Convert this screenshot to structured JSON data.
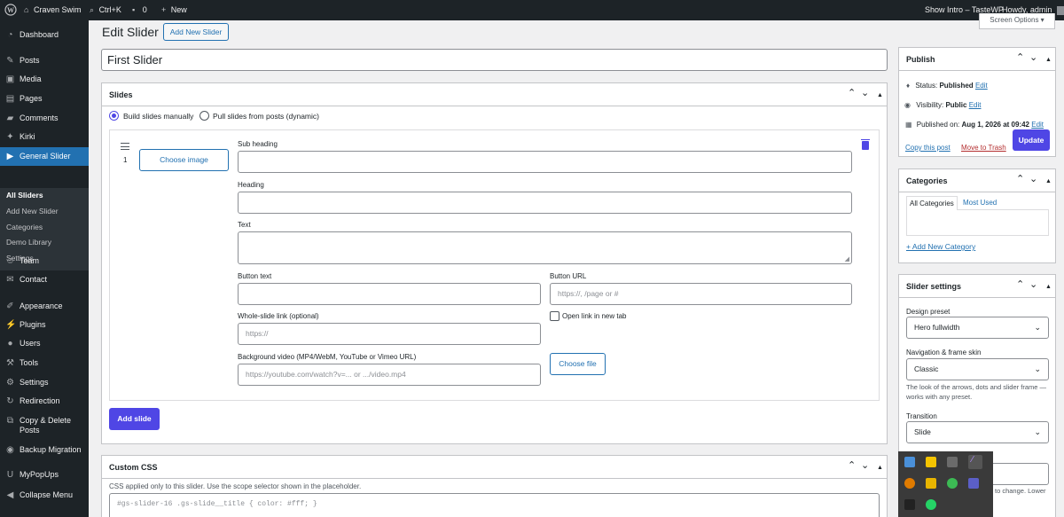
{
  "admin_bar": {
    "site_name": "Craven Swim",
    "shortcut": "Ctrl+K",
    "comments_count": "0",
    "new_label": "New",
    "show_intro": "Show Intro – TasteWP",
    "howdy": "Howdy, admin"
  },
  "sidebar": {
    "items": [
      {
        "label": "Dashboard",
        "icon": "dashboard-icon"
      },
      {
        "label": "Posts",
        "icon": "pin-icon"
      },
      {
        "label": "Media",
        "icon": "media-icon"
      },
      {
        "label": "Pages",
        "icon": "pages-icon"
      },
      {
        "label": "Comments",
        "icon": "comment-icon"
      },
      {
        "label": "Kirki",
        "icon": "kirki-icon"
      },
      {
        "label": "General Slider",
        "icon": "slider-icon"
      },
      {
        "label": "Team",
        "icon": "team-icon"
      },
      {
        "label": "Contact",
        "icon": "mail-icon"
      },
      {
        "label": "Appearance",
        "icon": "brush-icon"
      },
      {
        "label": "Plugins",
        "icon": "plugin-icon"
      },
      {
        "label": "Users",
        "icon": "user-icon"
      },
      {
        "label": "Tools",
        "icon": "wrench-icon"
      },
      {
        "label": "Settings",
        "icon": "settings-icon"
      },
      {
        "label": "Redirection",
        "icon": "redirect-icon"
      },
      {
        "label": "Copy & Delete",
        "label2": "Posts",
        "icon": "copy-icon"
      },
      {
        "label": "Backup Migration",
        "icon": "backup-icon"
      },
      {
        "label": "MyPopUps",
        "icon": "popup-icon"
      },
      {
        "label": "Collapse Menu",
        "icon": "collapse-icon"
      }
    ],
    "submenu": [
      "All Sliders",
      "Add New Slider",
      "Categories",
      "Demo Library",
      "Settings"
    ]
  },
  "page": {
    "title": "Edit Slider",
    "add_new": "Add New Slider",
    "screen_options": "Screen Options ▾",
    "slider_title": "First Slider"
  },
  "slides": {
    "title": "Slides",
    "radio_manual": "Build slides manually",
    "radio_posts": "Pull slides from posts (dynamic)",
    "slide_number": "1",
    "choose_image": "Choose image",
    "sub_heading": "Sub heading",
    "heading": "Heading",
    "text": "Text",
    "button_text": "Button text",
    "button_url": "Button URL",
    "button_url_placeholder": "https://, /page or #",
    "whole_link": "Whole-slide link (optional)",
    "whole_link_placeholder": "https://",
    "open_new_tab": "Open link in new tab",
    "bg_video": "Background video (MP4/WebM, YouTube or Vimeo URL)",
    "bg_video_placeholder": "https://youtube.com/watch?v=... or .../video.mp4",
    "choose_file": "Choose file",
    "add_slide": "Add slide"
  },
  "custom_css": {
    "title": "Custom CSS",
    "description": "CSS applied only to this slider. Use the scope selector shown in the placeholder.",
    "placeholder": "#gs-slider-16 .gs-slide__title { color: #fff; }"
  },
  "publish": {
    "title": "Publish",
    "status_label": "Status:",
    "status_value": "Published",
    "visibility_label": "Visibility:",
    "visibility_value": "Public",
    "published_label": "Published on:",
    "published_value": "Aug 1, 2026 at 09:42",
    "edit": "Edit",
    "copy": "Copy this post",
    "trash": "Move to Trash",
    "update": "Update"
  },
  "categories": {
    "title": "Categories",
    "tab_all": "All Categories",
    "tab_used": "Most Used",
    "add_new": "+ Add New Category"
  },
  "slider_settings": {
    "title": "Slider settings",
    "design_preset_label": "Design preset",
    "design_preset_value": "Hero fullwidth",
    "nav_label": "Navigation & frame skin",
    "nav_value": "Classic",
    "nav_help": "The look of the arrows, dots and slider frame — works with any preset.",
    "transition_label": "Transition",
    "transition_value": "Slide",
    "partial_text": "to change. Lower"
  },
  "colors": {
    "accent": "#4f46e5",
    "wp_blue": "#2271b1",
    "admin_dark": "#1d2327"
  }
}
